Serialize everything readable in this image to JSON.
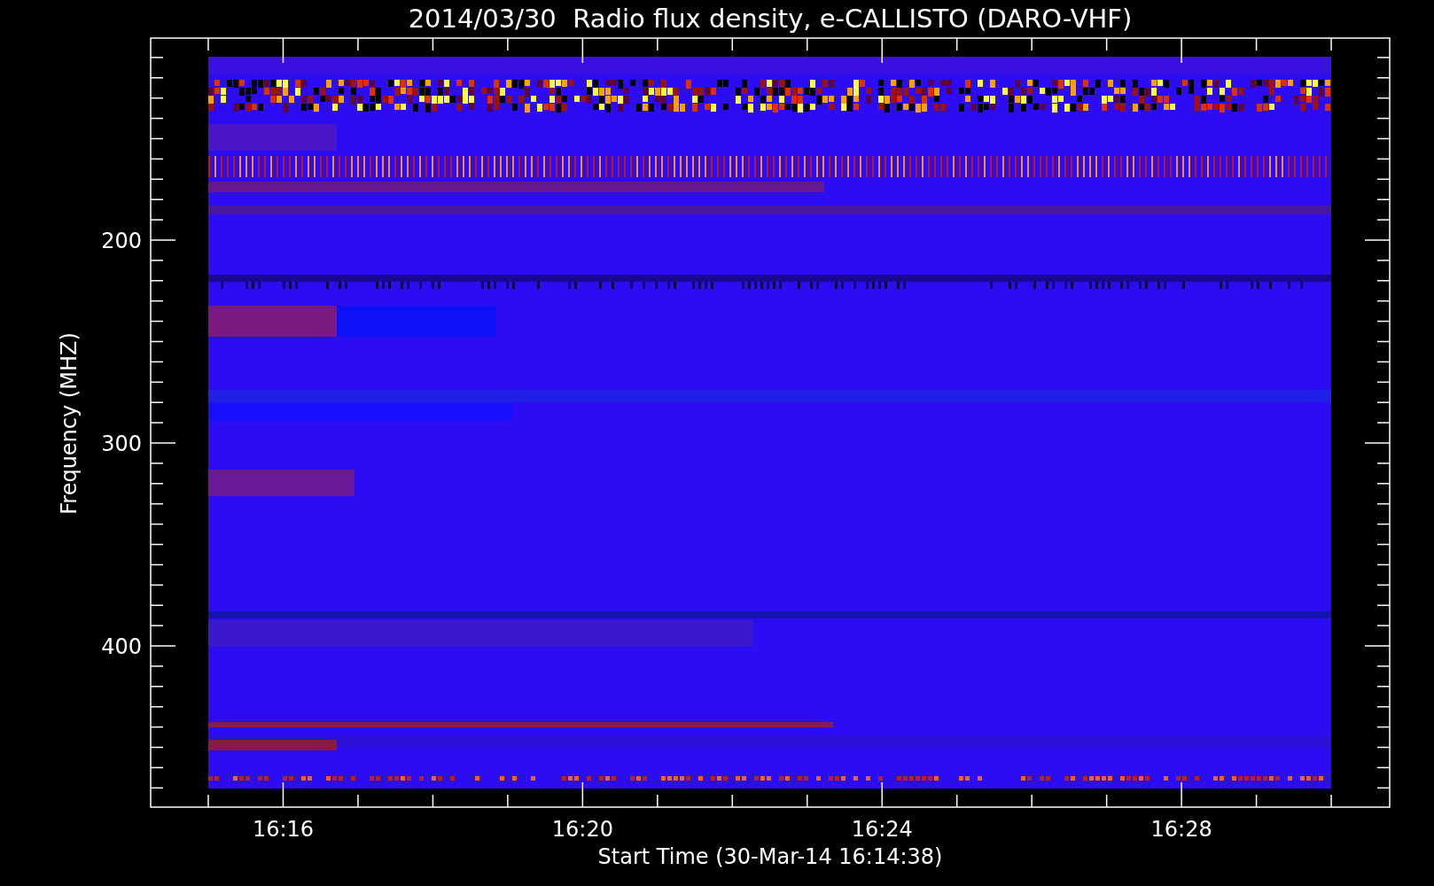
{
  "title": "2014/03/30  Radio flux density, e-CALLISTO (DARO-VHF)",
  "y_axis": {
    "label": "Frequency (MHZ)",
    "ticks": [
      "200",
      "300",
      "400"
    ]
  },
  "x_axis": {
    "label": "Start Time (30-Mar-14 16:14:38)",
    "ticks": [
      "16:16",
      "16:20",
      "16:24",
      "16:28"
    ]
  }
}
